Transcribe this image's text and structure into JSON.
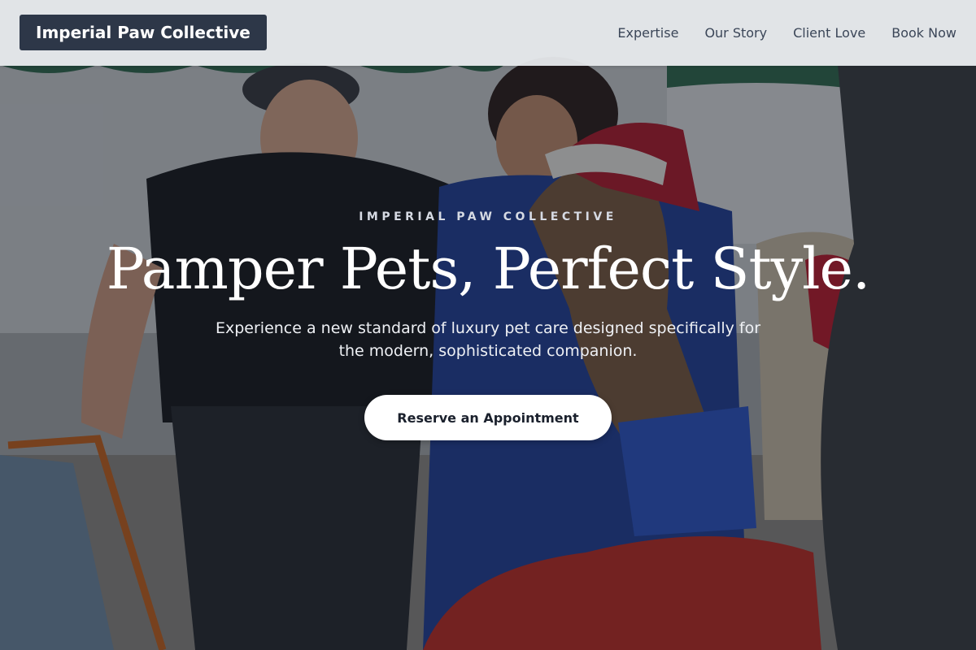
{
  "navbar": {
    "brand": "Imperial Paw Collective",
    "links": [
      {
        "label": "Expertise"
      },
      {
        "label": "Our Story"
      },
      {
        "label": "Client Love"
      },
      {
        "label": "Book Now"
      }
    ]
  },
  "hero": {
    "eyebrow": "IMPERIAL PAW COLLECTIVE",
    "headline": "Pamper Pets, Perfect Style.",
    "subtitle": "Experience a new standard of luxury pet care designed specifically for the modern, sophisticated companion.",
    "cta_label": "Reserve an Appointment",
    "background_image": "alpaca-visit-photo"
  },
  "colors": {
    "brand_bg": "#2d3748",
    "nav_text": "#3b4658",
    "cta_bg": "#ffffff",
    "cta_text": "#1a202c",
    "headline": "#ffffff"
  }
}
